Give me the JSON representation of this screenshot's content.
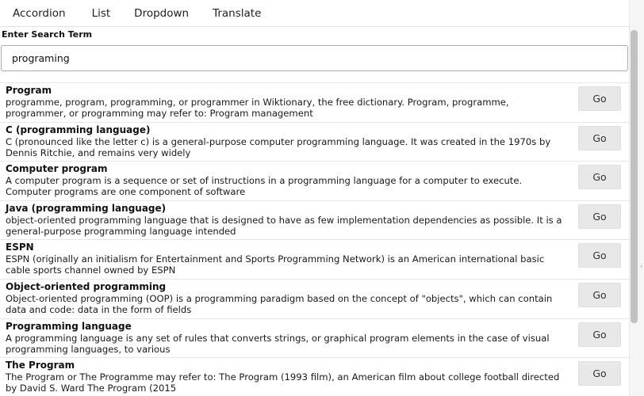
{
  "nav": {
    "items": [
      {
        "label": "Accordion"
      },
      {
        "label": "List"
      },
      {
        "label": "Dropdown"
      },
      {
        "label": "Translate"
      }
    ]
  },
  "search": {
    "label": "Enter Search Term",
    "value": "programing"
  },
  "results": [
    {
      "title": "Program",
      "snippet": "programme, program, programming, or programmer in Wiktionary, the free dictionary. Program, programme, programmer, or programming may refer to: Program management",
      "button": "Go"
    },
    {
      "title": "C (programming language)",
      "snippet": "C (pronounced like the letter c) is a general-purpose computer programming language. It was created in the 1970s by Dennis Ritchie, and remains very widely",
      "button": "Go"
    },
    {
      "title": "Computer program",
      "snippet": "A computer program is a sequence or set of instructions in a programming language for a computer to execute. Computer programs are one component of software",
      "button": "Go"
    },
    {
      "title": "Java (programming language)",
      "snippet": "object-oriented programming language that is designed to have as few implementation dependencies as possible. It is a general-purpose programming language intended",
      "button": "Go"
    },
    {
      "title": "ESPN",
      "snippet": "ESPN (originally an initialism for Entertainment and Sports Programming Network) is an American international basic cable sports channel owned by ESPN",
      "button": "Go"
    },
    {
      "title": "Object-oriented programming",
      "snippet": "Object-oriented programming (OOP) is a programming paradigm based on the concept of \"objects\", which can contain data and code: data in the form of fields",
      "button": "Go"
    },
    {
      "title": "Programming language",
      "snippet": "A programming language is any set of rules that converts strings, or graphical program elements in the case of visual programming languages, to various",
      "button": "Go"
    },
    {
      "title": "The Program",
      "snippet": "The Program or The Programme may refer to: The Program (1993 film), an American film about college football directed by David S. Ward The Program (2015",
      "button": "Go"
    }
  ],
  "scrollbar": {
    "arrow_icon": "chevron-icon"
  }
}
